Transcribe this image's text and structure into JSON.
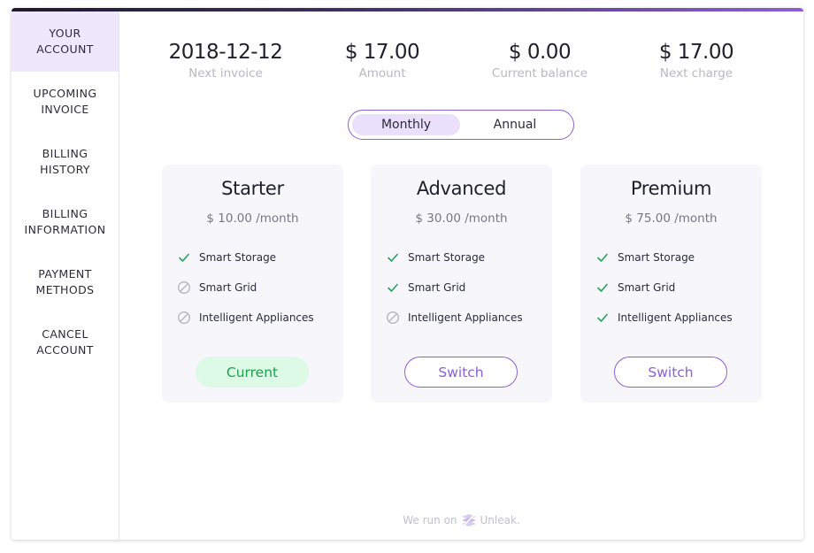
{
  "sidebar": {
    "items": [
      {
        "label": "YOUR\nACCOUNT",
        "active": true
      },
      {
        "label": "UPCOMING\nINVOICE",
        "active": false
      },
      {
        "label": "BILLING\nHISTORY",
        "active": false
      },
      {
        "label": "BILLING\nINFORMATION",
        "active": false
      },
      {
        "label": "PAYMENT\nMETHODS",
        "active": false
      },
      {
        "label": "CANCEL\nACCOUNT",
        "active": false
      }
    ]
  },
  "stats": [
    {
      "value": "2018-12-12",
      "label": "Next invoice"
    },
    {
      "value": "$ 17.00",
      "label": "Amount"
    },
    {
      "value": "$ 0.00",
      "label": "Current balance"
    },
    {
      "value": "$ 17.00",
      "label": "Next charge"
    }
  ],
  "billing_toggle": {
    "monthly": "Monthly",
    "annual": "Annual",
    "selected": "monthly"
  },
  "plans": [
    {
      "name": "Starter",
      "price": "$ 10.00 /month",
      "features": [
        {
          "label": "Smart Storage",
          "included": true
        },
        {
          "label": "Smart Grid",
          "included": false
        },
        {
          "label": "Intelligent Appliances",
          "included": false
        }
      ],
      "button": {
        "label": "Current",
        "kind": "current"
      }
    },
    {
      "name": "Advanced",
      "price": "$ 30.00 /month",
      "features": [
        {
          "label": "Smart Storage",
          "included": true
        },
        {
          "label": "Smart Grid",
          "included": true
        },
        {
          "label": "Intelligent Appliances",
          "included": false
        }
      ],
      "button": {
        "label": "Switch",
        "kind": "switch"
      }
    },
    {
      "name": "Premium",
      "price": "$ 75.00 /month",
      "features": [
        {
          "label": "Smart Storage",
          "included": true
        },
        {
          "label": "Smart Grid",
          "included": true
        },
        {
          "label": "Intelligent Appliances",
          "included": true
        }
      ],
      "button": {
        "label": "Switch",
        "kind": "switch"
      }
    }
  ],
  "footer": {
    "prefix": "We run on",
    "brand": "Unleak."
  },
  "colors": {
    "accent": "#8b5fd6",
    "check": "#22a55a",
    "excluded": "#b5b5bf",
    "current_bg": "#dcfae6",
    "current_text": "#1ea24f",
    "active_nav_bg": "#efe7fc"
  }
}
